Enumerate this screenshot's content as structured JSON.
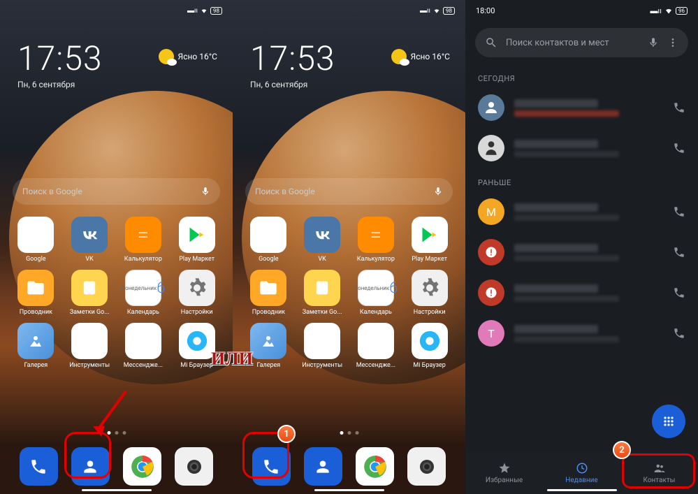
{
  "annotation": {
    "or_text": "ИЛИ"
  },
  "screen1": {
    "status": {
      "battery": "98"
    },
    "clock": "17:53",
    "date": "Пн, 6 сентября",
    "weather": {
      "text": "Ясно   16°C"
    },
    "search": {
      "placeholder": "Поиск в Google"
    },
    "apps": [
      {
        "label": "Google"
      },
      {
        "label": "VK"
      },
      {
        "label": "Калькулятор"
      },
      {
        "label": "Play Маркет"
      },
      {
        "label": "Проводник"
      },
      {
        "label": "Заметки Go..."
      },
      {
        "label": "Календарь",
        "day": "6"
      },
      {
        "label": "Настройки"
      },
      {
        "label": "Галерея"
      },
      {
        "label": "Инструменты"
      },
      {
        "label": "Мессендже..."
      },
      {
        "label": "Mi Браузер"
      }
    ]
  },
  "screen2": {
    "status": {
      "battery": "98"
    },
    "clock": "17:53",
    "date": "Пн, 6 сентября",
    "weather": {
      "text": "Ясно   16°C"
    },
    "search": {
      "placeholder": "Поиск в Google"
    },
    "apps": [
      {
        "label": "Google"
      },
      {
        "label": "VK"
      },
      {
        "label": "Калькулятор"
      },
      {
        "label": "Play Маркет"
      },
      {
        "label": "Проводник"
      },
      {
        "label": "Заметки Go..."
      },
      {
        "label": "Календарь",
        "day": "6"
      },
      {
        "label": "Настройки"
      },
      {
        "label": "Галерея"
      },
      {
        "label": "Инструменты"
      },
      {
        "label": "Мессендже..."
      },
      {
        "label": "Mi Браузер"
      }
    ],
    "badge1": "1"
  },
  "screen3": {
    "status": {
      "time": "18:00",
      "battery": "96"
    },
    "search": {
      "placeholder": "Поиск контактов и мест"
    },
    "sections": {
      "today": "СЕГОДНЯ",
      "earlier": "РАНЬШЕ"
    },
    "items": [
      {
        "avatar_bg": "#5a7a9a"
      },
      {
        "avatar_bg": "#d8d8d8",
        "silhouette": true
      },
      {
        "avatar_bg": "#f5a623",
        "letter": "M"
      },
      {
        "avatar_bg": "#c03a2a",
        "icon": "spam"
      },
      {
        "avatar_bg": "#c03a2a",
        "icon": "spam"
      },
      {
        "avatar_bg": "#e17ab8",
        "letter": "T"
      }
    ],
    "tabs": {
      "favorites": "Избранные",
      "recent": "Недавние",
      "contacts": "Контакты"
    },
    "badge2": "2"
  }
}
